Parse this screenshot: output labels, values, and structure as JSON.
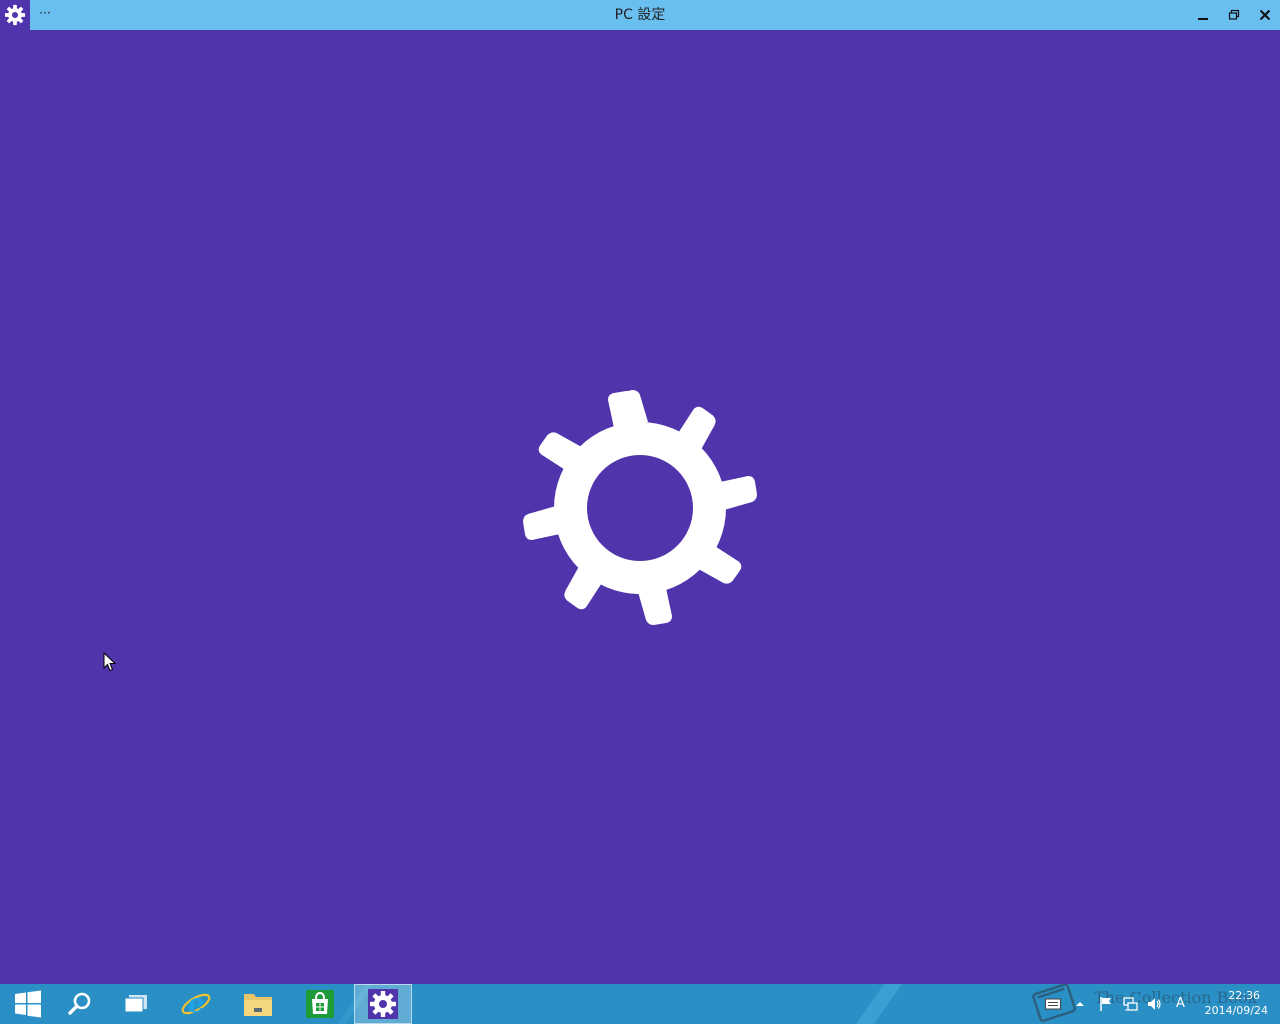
{
  "window": {
    "title": "PC 設定",
    "menu_label": "···",
    "accent_color": "#5034ac",
    "titlebar_color": "#69bff0"
  },
  "splash": {
    "icon": "gear-icon",
    "background_color": "#5034ac"
  },
  "taskbar": {
    "items": [
      {
        "name": "start-button",
        "icon": "windows-logo-icon"
      },
      {
        "name": "search-button",
        "icon": "search-icon"
      },
      {
        "name": "task-view-button",
        "icon": "task-view-icon"
      },
      {
        "name": "internet-explorer-button",
        "icon": "ie-icon"
      },
      {
        "name": "file-explorer-button",
        "icon": "folder-icon"
      },
      {
        "name": "store-button",
        "icon": "store-icon"
      },
      {
        "name": "pc-settings-button",
        "icon": "gear-icon",
        "active": true
      }
    ],
    "tray": {
      "ime_label": "A",
      "clock_time": "22:36",
      "clock_date": "2014/09/24",
      "watermark_text": "The Collection Book"
    }
  }
}
